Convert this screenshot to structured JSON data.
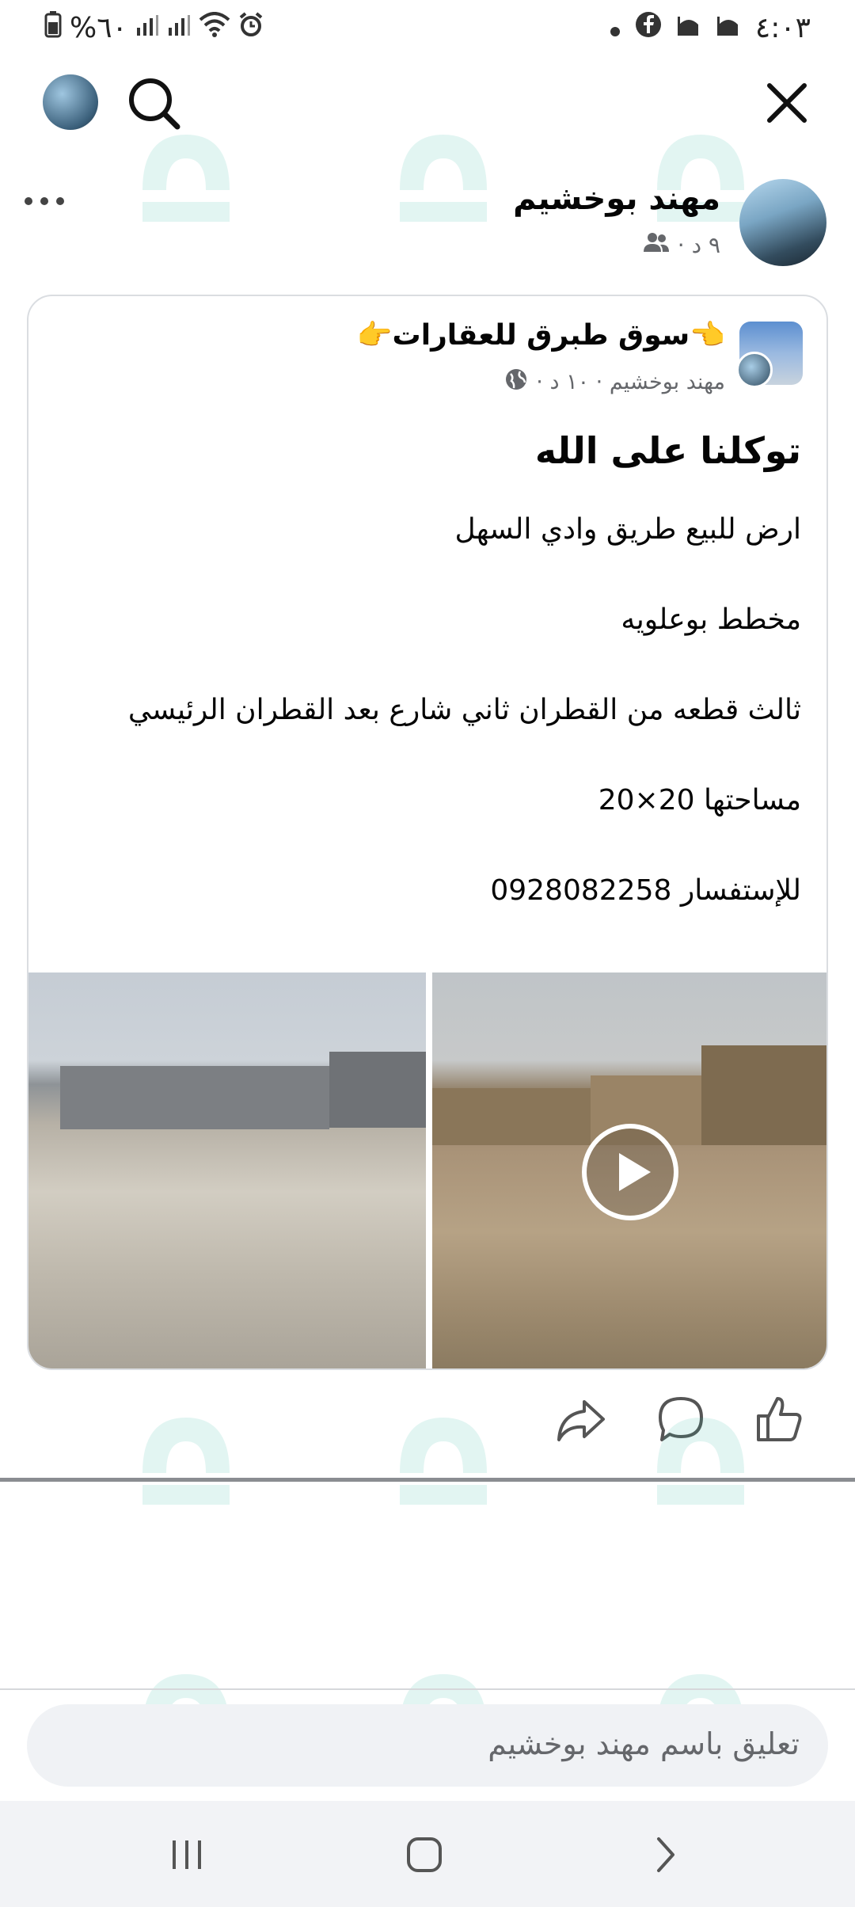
{
  "status_bar": {
    "battery_text": "%٦٠",
    "time": "٤:٠٣"
  },
  "top_bar": {
    "search_icon": "search-icon",
    "close_icon": "close-icon"
  },
  "post": {
    "author_name": "مهند بوخشيم",
    "author_meta": "٩ د ·",
    "audience_icon": "friends-icon"
  },
  "shared_post": {
    "group_name": "👈سوق طبرق للعقارات👉",
    "meta": "مهند بوخشيم · ١٠ د ·",
    "privacy_icon": "globe-icon",
    "title": "توكلنا على الله",
    "lines": [
      "ارض للبيع طريق وادي السهل",
      "مخطط بوعلويه",
      "ثالث قطعه من القطران ثاني شارع بعد القطران الرئيسي",
      "مساحتها 20×20",
      "للإستفسار 0928082258"
    ]
  },
  "actions": [
    "share-icon",
    "comment-icon",
    "like-icon"
  ],
  "comment": {
    "placeholder": "تعليق باسم مهند بوخشيم"
  },
  "colors": {
    "text": "#050505",
    "secondary": "#65676b",
    "watermark": "#2bb5a0"
  }
}
